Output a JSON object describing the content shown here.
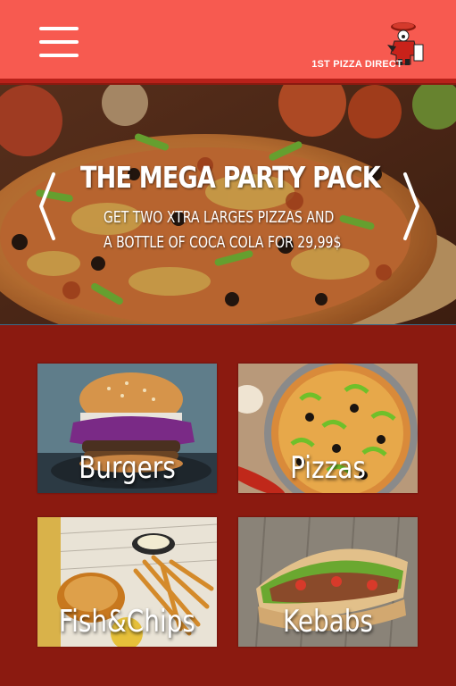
{
  "header": {
    "menu_icon": "hamburger-menu-icon",
    "logo_icon": "chef-mascot-logo",
    "brand_name": "1ST PIZZA DIRECT",
    "bg_color": "#f75a50"
  },
  "hero": {
    "title": "THE MEGA PARTY PACK",
    "line1": "GET TWO XTRA LARGES PIZZAS AND",
    "line2": "A BOTTLE OF COCA COLA FOR 29,99$",
    "prev_icon": "chevron-left-icon",
    "next_icon": "chevron-right-icon"
  },
  "categories": [
    {
      "label": "Burgers"
    },
    {
      "label": "Pizzas"
    },
    {
      "label": "Fish&Chips"
    },
    {
      "label": "Kebabs"
    }
  ],
  "colors": {
    "background": "#8b1a10",
    "accent": "#f75a50"
  }
}
